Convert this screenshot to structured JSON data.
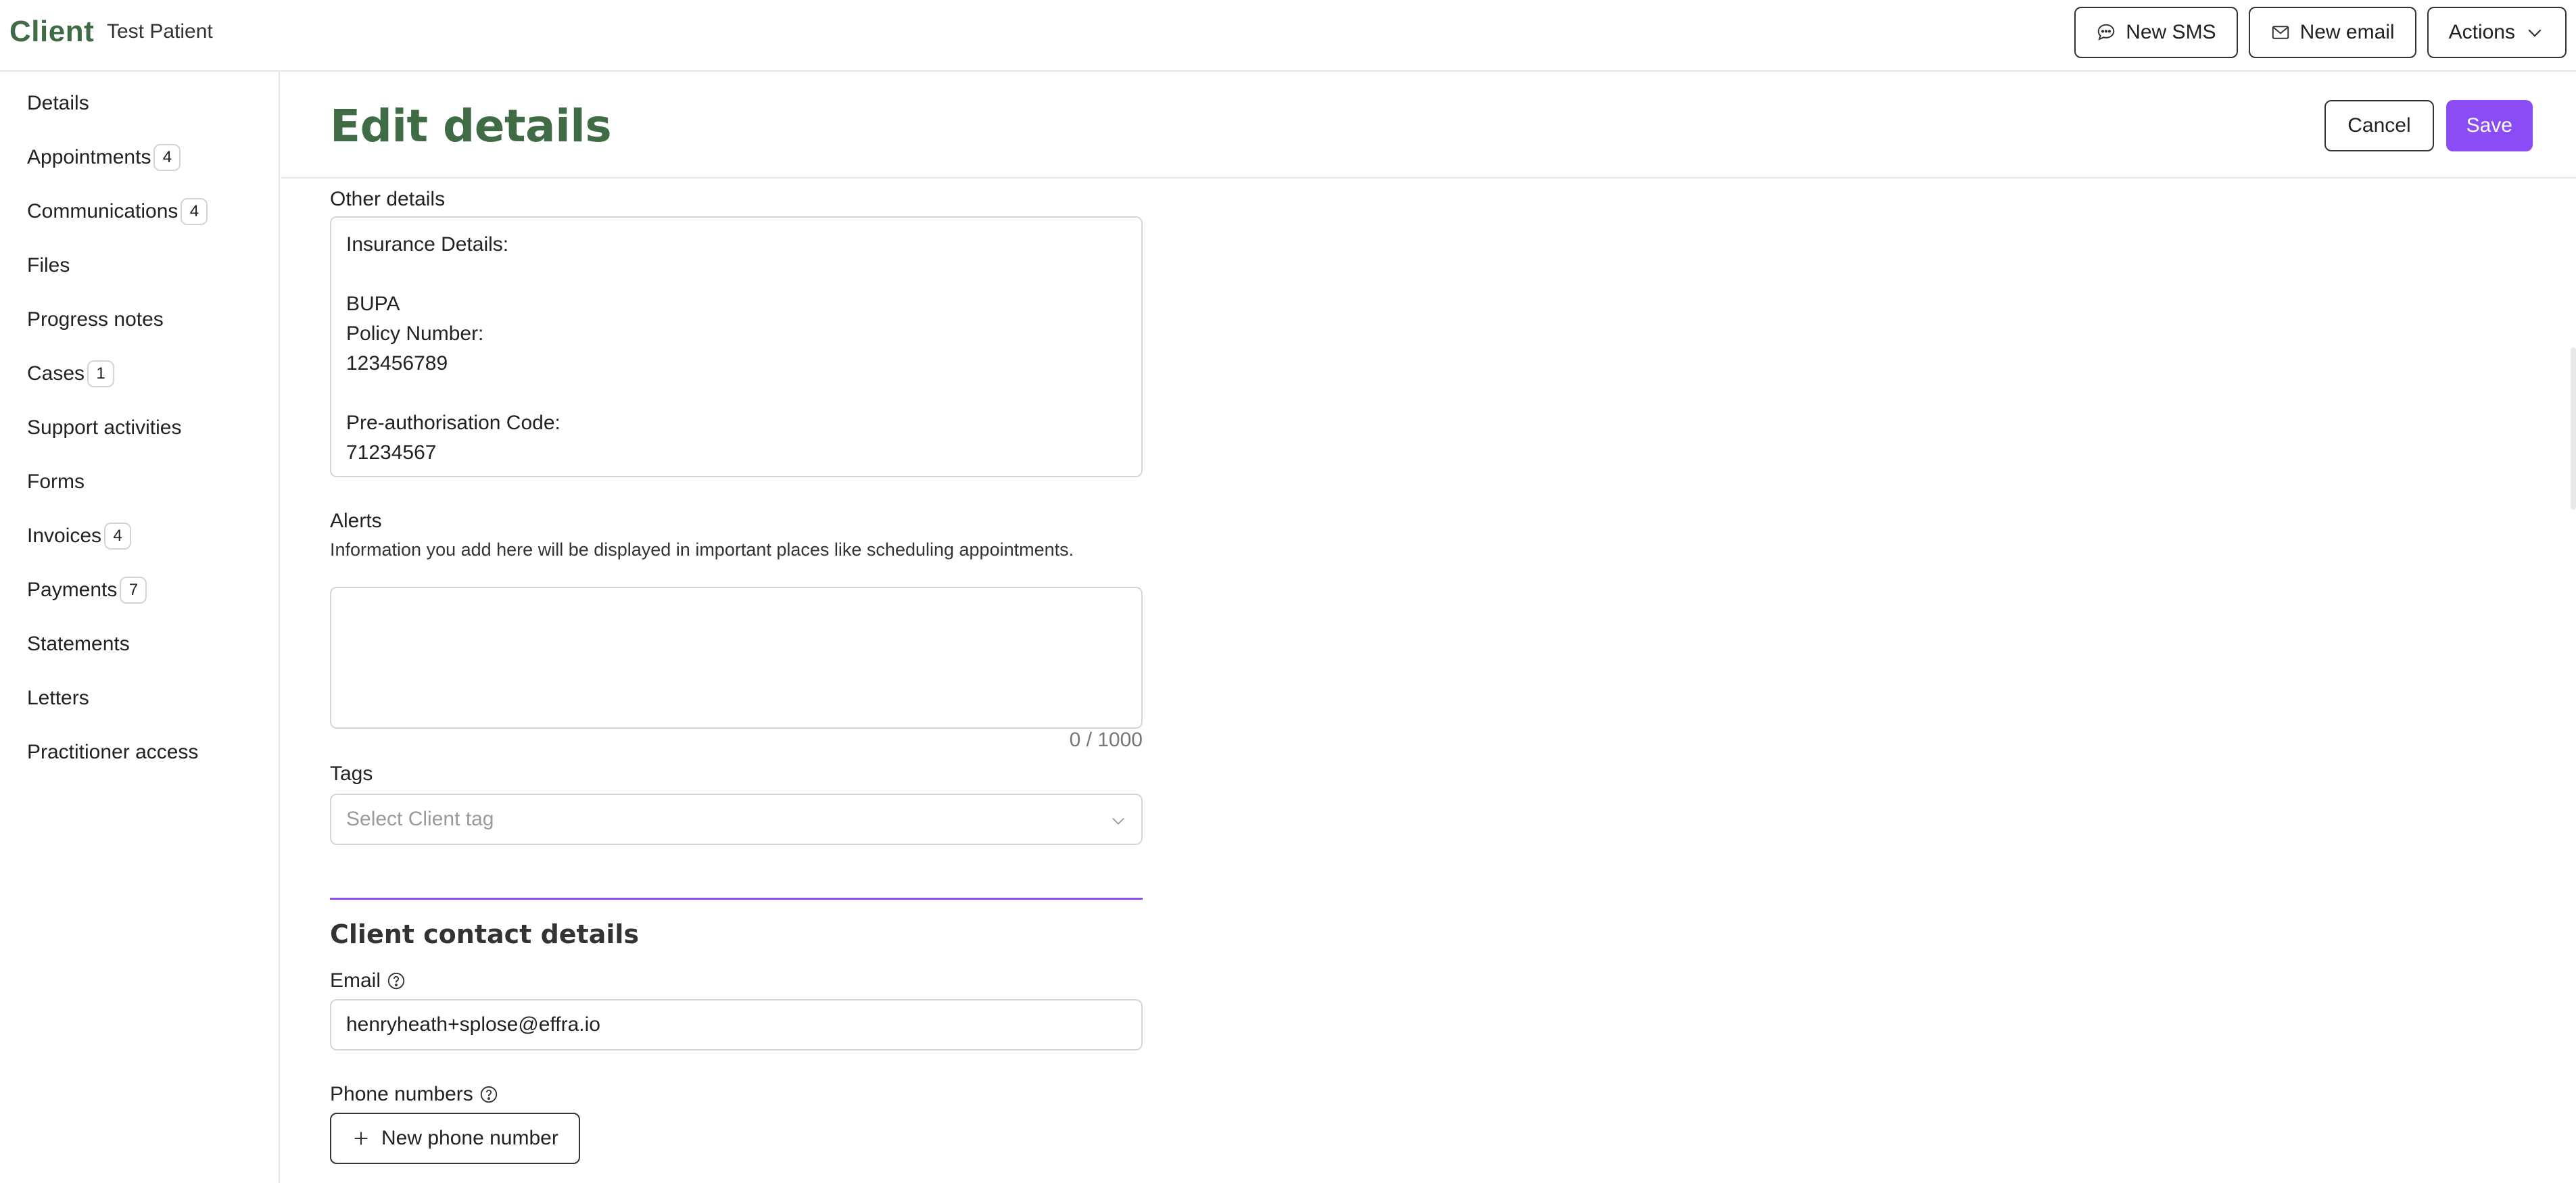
{
  "topbar": {
    "brand": "Client",
    "patient_name": "Test Patient",
    "new_sms_label": "New SMS",
    "new_email_label": "New email",
    "actions_label": "Actions"
  },
  "sidebar": {
    "items": [
      {
        "label": "Details",
        "badge": null
      },
      {
        "label": "Appointments",
        "badge": "4"
      },
      {
        "label": "Communications",
        "badge": "4"
      },
      {
        "label": "Files",
        "badge": null
      },
      {
        "label": "Progress notes",
        "badge": null
      },
      {
        "label": "Cases",
        "badge": "1"
      },
      {
        "label": "Support activities",
        "badge": null
      },
      {
        "label": "Forms",
        "badge": null
      },
      {
        "label": "Invoices",
        "badge": "4"
      },
      {
        "label": "Payments",
        "badge": "7"
      },
      {
        "label": "Statements",
        "badge": null
      },
      {
        "label": "Letters",
        "badge": null
      },
      {
        "label": "Practitioner access",
        "badge": null
      }
    ]
  },
  "header": {
    "title": "Edit details",
    "cancel_label": "Cancel",
    "save_label": "Save"
  },
  "form": {
    "other_details_label": "Other details",
    "other_details_value": "Insurance Details:\n\nBUPA\nPolicy Number:\n123456789\n\nPre-authorisation Code:\n71234567",
    "alerts_label": "Alerts",
    "alerts_helper": "Information you add here will be displayed in important places like scheduling appointments.",
    "alerts_value": "",
    "alerts_counter": "0 / 1000",
    "tags_label": "Tags",
    "tags_placeholder": "Select Client tag",
    "contact_section_title": "Client contact details",
    "email_label": "Email",
    "email_value": "henryheath+splose@effra.io",
    "phone_label": "Phone numbers",
    "new_phone_label": "New phone number"
  },
  "colors": {
    "brand_green": "#3f6b45",
    "accent_purple": "#8b4cf5"
  }
}
